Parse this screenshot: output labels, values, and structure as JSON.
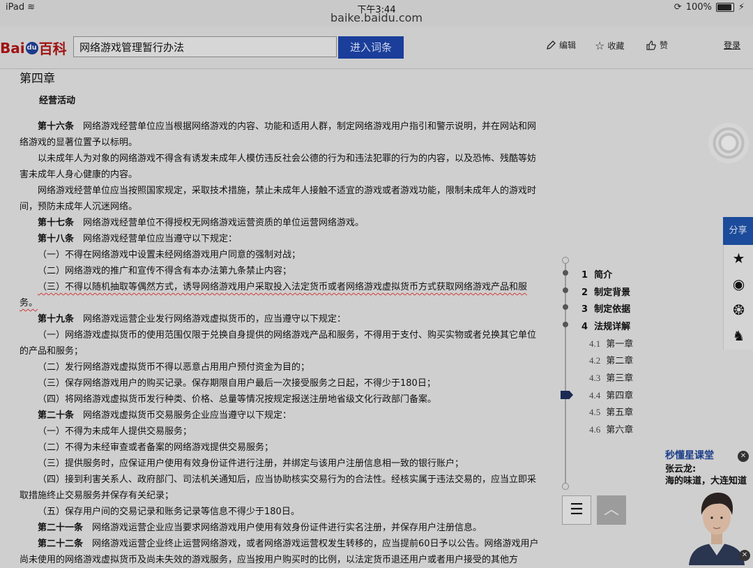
{
  "status": {
    "device": "iPad",
    "time": "下午3:44",
    "url": "baike.baidu.com",
    "battery": "100%"
  },
  "header": {
    "logo_left": "Bai",
    "logo_mid": "du",
    "logo_right": "百科",
    "search_value": "网络游戏管理暂行办法",
    "enter_label": "进入词条",
    "edit_label": "编辑",
    "fav_label": "收藏",
    "like_label": "赞",
    "login_label": "登录"
  },
  "content": {
    "chapter": "第四章",
    "section": "经营活动",
    "paragraphs": [
      {
        "lead": "第十六条",
        "text": "　网络游戏经营单位应当根据网络游戏的内容、功能和适用人群，制定网络游戏用户指引和警示说明，并在网站和网络游戏的显著位置予以标明。"
      },
      {
        "lead": "",
        "text": "以未成年人为对象的网络游戏不得含有诱发未成年人模仿违反社会公德的行为和违法犯罪的行为的内容，以及恐怖、残酷等妨害未成年人身心健康的内容。"
      },
      {
        "lead": "",
        "text": "网络游戏经营单位应当按照国家规定，采取技术措施，禁止未成年人接触不适宜的游戏或者游戏功能，限制未成年人的游戏时间，预防未成年人沉迷网络。"
      },
      {
        "lead": "第十七条",
        "text": "　网络游戏经营单位不得授权无网络游戏运营资质的单位运营网络游戏。"
      },
      {
        "lead": "第十八条",
        "text": "　网络游戏经营单位应当遵守以下规定："
      },
      {
        "lead": "",
        "text": "（一）不得在网络游戏中设置未经网络游戏用户同意的强制对战；"
      },
      {
        "lead": "",
        "text": "（二）网络游戏的推广和宣传不得含有本办法第九条禁止内容；"
      },
      {
        "lead": "",
        "text": "（三）不得以随机抽取等偶然方式，诱导网络游戏用户采取投入法定货币或者网络游戏虚拟货币方式获取网络游戏产品和服务。",
        "underline": true
      },
      {
        "lead": "第十九条",
        "text": "　网络游戏运营企业发行网络游戏虚拟货币的，应当遵守以下规定："
      },
      {
        "lead": "",
        "text": "（一）网络游戏虚拟货币的使用范围仅限于兑换自身提供的网络游戏产品和服务，不得用于支付、购买实物或者兑换其它单位的产品和服务；"
      },
      {
        "lead": "",
        "text": "（二）发行网络游戏虚拟货币不得以恶意占用用户预付资金为目的；"
      },
      {
        "lead": "",
        "text": "（三）保存网络游戏用户的购买记录。保存期限自用户最后一次接受服务之日起，不得少于180日；"
      },
      {
        "lead": "",
        "text": "（四）将网络游戏虚拟货币发行种类、价格、总量等情况按规定报送注册地省级文化行政部门备案。"
      },
      {
        "lead": "第二十条",
        "text": "　网络游戏虚拟货币交易服务企业应当遵守以下规定："
      },
      {
        "lead": "",
        "text": "（一）不得为未成年人提供交易服务；"
      },
      {
        "lead": "",
        "text": "（二）不得为未经审查或者备案的网络游戏提供交易服务；"
      },
      {
        "lead": "",
        "text": "（三）提供服务时，应保证用户使用有效身份证件进行注册，并绑定与该用户注册信息相一致的银行账户；"
      },
      {
        "lead": "",
        "text": "（四）接到利害关系人、政府部门、司法机关通知后，应当协助核实交易行为的合法性。经核实属于违法交易的，应当立即采取措施终止交易服务并保存有关纪录；"
      },
      {
        "lead": "",
        "text": "（五）保存用户间的交易记录和账务记录等信息不得少于180日。"
      },
      {
        "lead": "第二十一条",
        "text": "　网络游戏运营企业应当要求网络游戏用户使用有效身份证件进行实名注册，并保存用户注册信息。"
      },
      {
        "lead": "第二十二条",
        "text": "　网络游戏运营企业终止运营网络游戏，或者网络游戏运营权发生转移的，应当提前60日予以公告。网络游戏用户尚未使用的网络游戏虚拟货币及尚未失效的游戏服务，应当按用户购买时的比例，以法定货币退还用户或者用户接受的其他方"
      }
    ]
  },
  "share": {
    "label": "分享"
  },
  "toc": {
    "items": [
      {
        "num": "1",
        "label": "简介"
      },
      {
        "num": "2",
        "label": "制定背景"
      },
      {
        "num": "3",
        "label": "制定依据"
      },
      {
        "num": "4",
        "label": "法规详解"
      }
    ],
    "subs": [
      {
        "num": "4.1",
        "label": "第一章"
      },
      {
        "num": "4.2",
        "label": "第二章"
      },
      {
        "num": "4.3",
        "label": "第三章"
      },
      {
        "num": "4.4",
        "label": "第四章"
      },
      {
        "num": "4.5",
        "label": "第五章"
      },
      {
        "num": "4.6",
        "label": "第六章"
      }
    ]
  },
  "ad": {
    "title": "秒懂星课堂",
    "line1": "张云龙:",
    "line2": "海的味道，大连知道"
  }
}
